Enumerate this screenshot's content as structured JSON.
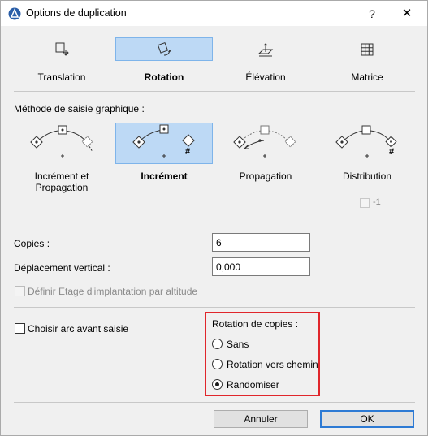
{
  "window": {
    "title": "Options de duplication",
    "help_label": "?",
    "close_label": "✕"
  },
  "tabs": [
    {
      "label": "Translation",
      "icon": "translation-icon",
      "active": false
    },
    {
      "label": "Rotation",
      "icon": "rotation-icon",
      "active": true
    },
    {
      "label": "Élévation",
      "icon": "elevation-icon",
      "active": false
    },
    {
      "label": "Matrice",
      "icon": "matrix-icon",
      "active": false
    }
  ],
  "method_section": {
    "label": "Méthode de saisie graphique :",
    "options": [
      {
        "label": "Incrément et\nPropagation",
        "active": false
      },
      {
        "label": "Incrément",
        "active": true
      },
      {
        "label": "Propagation",
        "active": false
      },
      {
        "label": "Distribution",
        "active": false
      }
    ],
    "distribution_check_label": "-1",
    "hash_glyph": "#"
  },
  "fields": {
    "copies_label": "Copies :",
    "copies_value": "6",
    "vertical_label": "Déplacement vertical :",
    "vertical_value": "0,000",
    "elevation_check_label": "Définir Etage d'implantation par altitude"
  },
  "arc": {
    "label": "Choisir arc avant saisie"
  },
  "rotation_copies": {
    "title": "Rotation de copies :",
    "options": [
      {
        "label": "Sans",
        "selected": false
      },
      {
        "label": "Rotation vers chemin",
        "selected": false
      },
      {
        "label": "Randomiser",
        "selected": true
      }
    ]
  },
  "buttons": {
    "cancel": "Annuler",
    "ok": "OK"
  },
  "colors": {
    "selection_bg": "#bdd9f5",
    "selection_border": "#7eb4ea",
    "highlight_red": "#e0262b",
    "default_button_border": "#2d7ad4"
  }
}
